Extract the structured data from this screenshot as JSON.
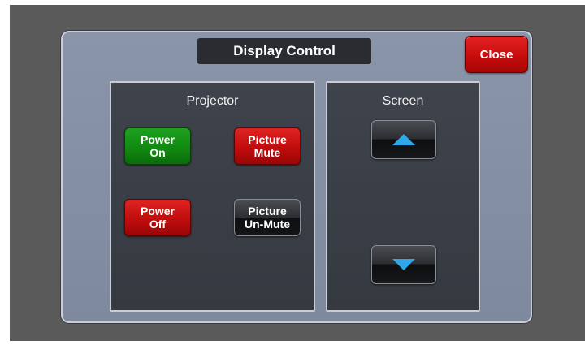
{
  "dialog": {
    "title": "Display Control",
    "close_label": "Close"
  },
  "projector": {
    "title": "Projector",
    "power_on": {
      "line1": "Power",
      "line2": "On"
    },
    "power_off": {
      "line1": "Power",
      "line2": "Off"
    },
    "picture_mute": {
      "line1": "Picture",
      "line2": "Mute"
    },
    "picture_unmute": {
      "line1": "Picture",
      "line2": "Un-Mute"
    }
  },
  "screen": {
    "title": "Screen",
    "up_icon": "triangle-up-icon",
    "down_icon": "triangle-down-icon"
  },
  "colors": {
    "background": "#5a5a5a",
    "dialog": "#8590a5",
    "panel": "#3b3f47",
    "green": "#118a11",
    "red": "#c40b0b",
    "arrow": "#2ea8ea"
  }
}
